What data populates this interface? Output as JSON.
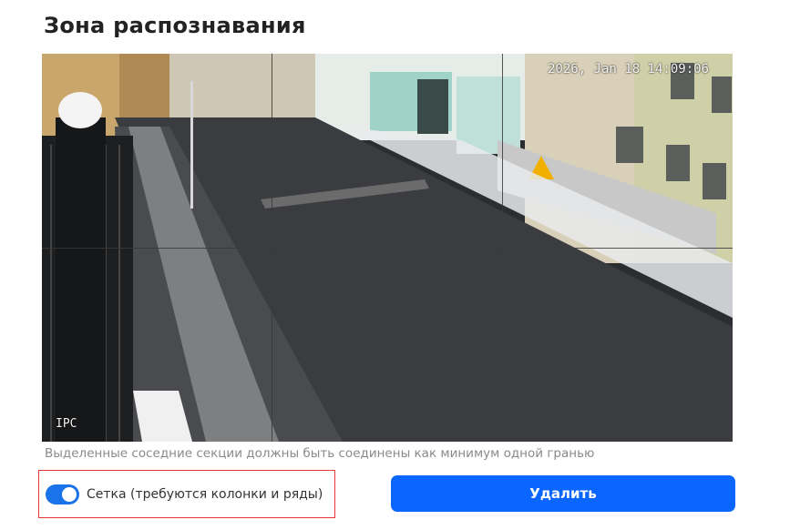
{
  "header": {
    "title": "Зона распознавания"
  },
  "camera": {
    "timestamp": "2026, Jan 18 14:09:06",
    "label": "IPC",
    "grid": {
      "columns": 3,
      "rows": 2
    }
  },
  "hint": {
    "text": "Выделенные соседние секции должны быть соединены как минимум одной гранью"
  },
  "grid_toggle": {
    "label": "Сетка (требуются колонки и ряды)",
    "checked": true
  },
  "actions": {
    "delete_label": "Удалить"
  },
  "colors": {
    "accent": "#0a66ff",
    "highlight_border": "#e53935"
  }
}
